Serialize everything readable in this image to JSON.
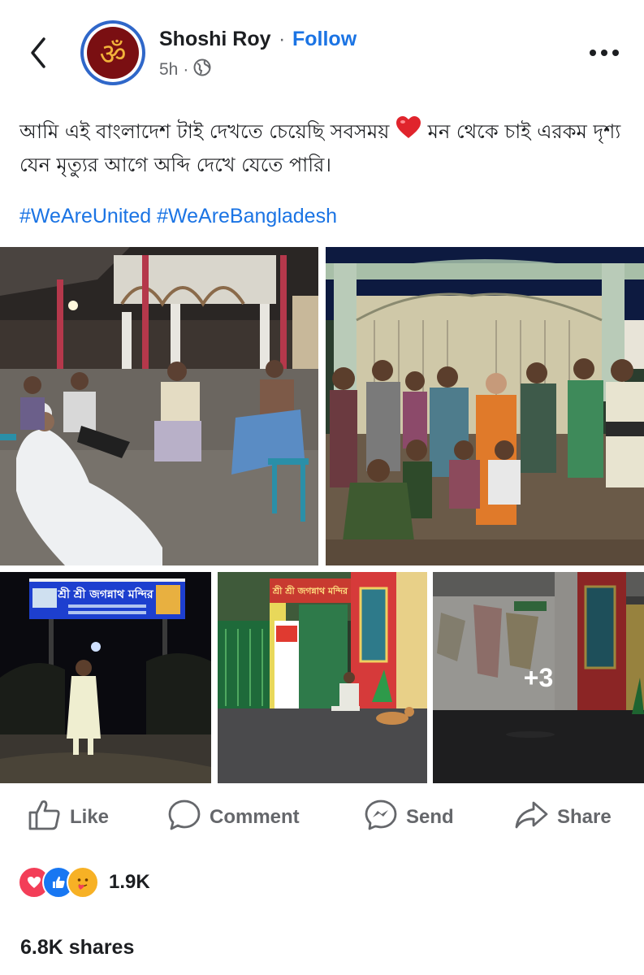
{
  "post": {
    "author": "Shoshi Roy",
    "separator": "·",
    "follow_label": "Follow",
    "time": "5h",
    "meta_separator": "·",
    "text_part1": "আমি এই বাংলাদেশ টাই দেখতে চেয়েছি সবসময়",
    "text_part2": "মন থেকে চাই এরকম দৃশ্য যেন মৃত্যুর আগে অব্দি দেখে যেতে পারি।",
    "hashtags": [
      "#WeAreUnited",
      "#WeAreBangladesh"
    ],
    "more_photos": "+3"
  },
  "photos": {
    "sign_line1": "শ্রী শ্রী জগন্নাথ মন্দির",
    "gate_banner": "শ্রী শ্রী জগন্নাথ মন্দির"
  },
  "actions": {
    "like": "Like",
    "comment": "Comment",
    "send": "Send",
    "share": "Share"
  },
  "reactions": {
    "count": "1.9K",
    "types": [
      "love-icon",
      "like-icon",
      "care-icon"
    ]
  },
  "shares": "6.8K shares",
  "colors": {
    "link_blue": "#1b74e4",
    "text": "#1c1e21",
    "muted": "#65676b"
  }
}
